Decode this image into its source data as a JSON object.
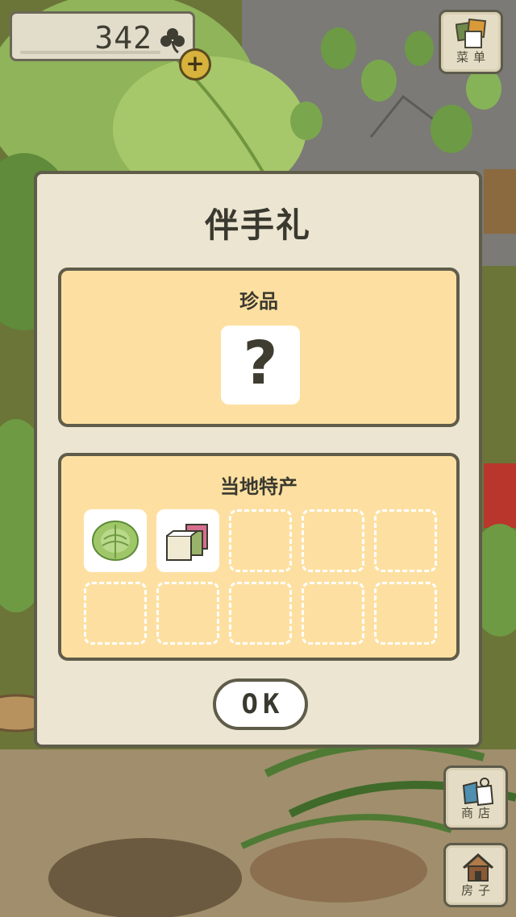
{
  "currency": {
    "value": "342",
    "icon": "clover-icon",
    "add_label": "+"
  },
  "menu_button": {
    "label": "菜单",
    "icon": "menu-cards-icon"
  },
  "shop_button": {
    "label": "商店",
    "icon": "shop-bags-icon"
  },
  "house_button": {
    "label": "房子",
    "icon": "house-icon"
  },
  "dialog": {
    "title": "伴手礼",
    "rare_section": {
      "title": "珍品",
      "item": "?"
    },
    "local_section": {
      "title": "当地特产",
      "items": [
        {
          "name": "cabbage-icon",
          "filled": true
        },
        {
          "name": "rice-cake-icon",
          "filled": true
        },
        {
          "filled": false
        },
        {
          "filled": false
        },
        {
          "filled": false
        },
        {
          "filled": false
        },
        {
          "filled": false
        },
        {
          "filled": false
        },
        {
          "filled": false
        },
        {
          "filled": false
        }
      ]
    },
    "ok_label": "OK"
  },
  "colors": {
    "panel_bg": "#fde0a1",
    "dialog_bg": "#ece5d2",
    "border": "#5f5c4a",
    "leaf_green": "#7fa84a",
    "rock_gray": "#7c7a74"
  }
}
